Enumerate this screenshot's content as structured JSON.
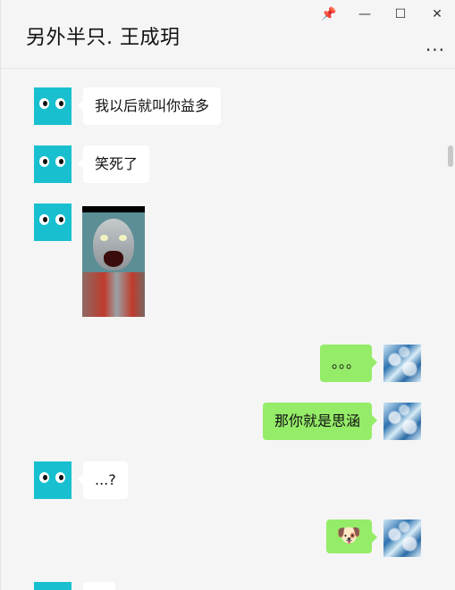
{
  "window": {
    "title": "另外半只. 王成玥",
    "pin_icon": "📌",
    "minimize_icon": "—",
    "maximize_icon": "☐",
    "close_icon": "✕",
    "more_icon": "···"
  },
  "messages": [
    {
      "sender": "other",
      "text": "我以后就叫你益多"
    },
    {
      "sender": "other",
      "text": "笑死了"
    },
    {
      "sender": "other",
      "type": "image",
      "icon": "ultraman-meme-image"
    },
    {
      "sender": "me",
      "text": "。。。"
    },
    {
      "sender": "me",
      "text": "那你就是思涵"
    },
    {
      "sender": "other",
      "text": "...?"
    },
    {
      "sender": "me",
      "text": "🐶"
    }
  ],
  "colors": {
    "background": "#f5f5f5",
    "my_bubble": "#95ec69",
    "other_bubble": "#ffffff",
    "other_avatar": "#18c0cf"
  }
}
